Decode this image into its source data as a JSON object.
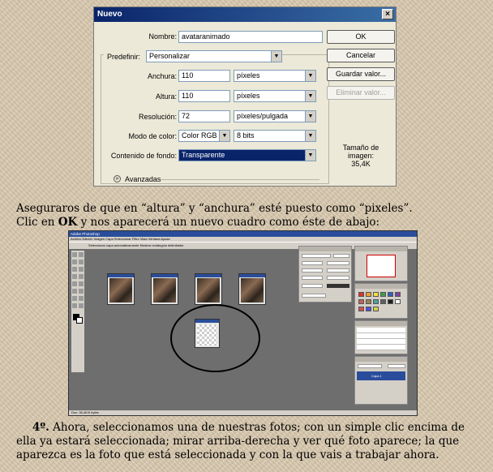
{
  "dialog": {
    "title": "Nuevo",
    "close_glyph": "×",
    "nombre_label": "Nombre:",
    "nombre_value": "avataranimado",
    "predefinir_label": "Predefinir:",
    "predefinir_value": "Personalizar",
    "anchura_label": "Anchura:",
    "anchura_value": "110",
    "anchura_unit": "píxeles",
    "altura_label": "Altura:",
    "altura_value": "110",
    "altura_unit": "píxeles",
    "resolucion_label": "Resolución:",
    "resolucion_value": "72",
    "resolucion_unit": "píxeles/pulgada",
    "modo_label": "Modo de color:",
    "modo_value": "Color RGB",
    "bits_value": "8 bits",
    "fondo_label": "Contenido de fondo:",
    "fondo_value": "Transparente",
    "avanzadas_label": "Avanzadas",
    "buttons": {
      "ok": "OK",
      "cancelar": "Cancelar",
      "guardar": "Guardar valor...",
      "eliminar": "Eliminar valor..."
    },
    "tamano_label": "Tamaño de imagen:",
    "tamano_value": "35,4K",
    "dropdown_glyph": "▼"
  },
  "text1": {
    "line1": "Aseguraros de que en “altura” y “anchura” esté puesto como “pixeles”.",
    "line2_pre": "Clic en ",
    "line2_bold": "OK",
    "line2_post": " y nos aparecerá un nuevo cuadro como éste de abajo:"
  },
  "photoshop": {
    "title": "Adobe Photoshop",
    "menu": "Archivo  Edición  Imagen  Capa  Seleccionar  Filtro  Vista  Ventana  Ayuda",
    "options": "Seleccionar capa automáticamente   Mostrar rectángulo delimitador",
    "status": "Doc: 35,4K/0 bytes",
    "layer_name": "Capa 1",
    "colors": {
      "canvas_bg": "#6e6e6e",
      "accent": "#2a4d9b"
    }
  },
  "text2": {
    "step_number": "4º.",
    "body": " Ahora, seleccionamos una de nuestras fotos; con un simple clic encima de ella ya estará seleccionada; mirar arriba-derecha y ver qué foto aparece; la que aparezca es la foto que está seleccionada y con la que vais a trabajar ahora."
  }
}
